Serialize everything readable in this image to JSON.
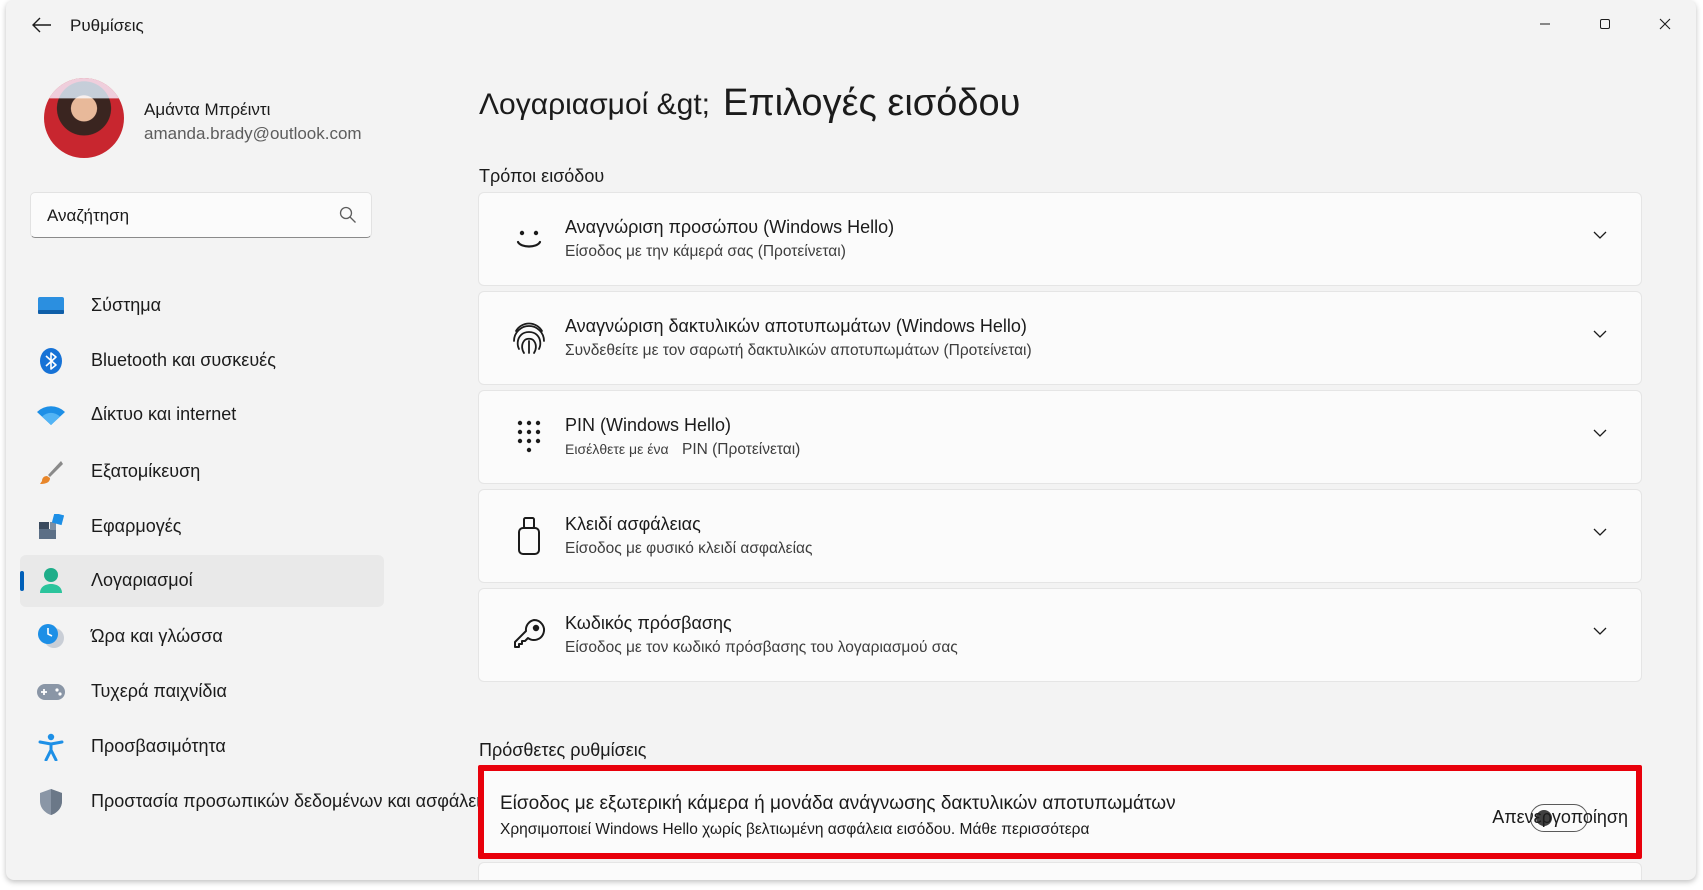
{
  "window": {
    "title": "Ρυθμίσεις"
  },
  "profile": {
    "name": "Αμάντα Μπρέιντι",
    "email": "amanda.brady@outlook.com"
  },
  "search": {
    "placeholder": "Αναζήτηση"
  },
  "nav": {
    "items": [
      {
        "label": "Σύστημα",
        "icon": "monitor-icon"
      },
      {
        "label": "Bluetooth και συσκευές",
        "icon": "bluetooth-icon"
      },
      {
        "label": "Δίκτυο και internet",
        "icon": "wifi-icon"
      },
      {
        "label": "Εξατομίκευση",
        "icon": "paintbrush-icon"
      },
      {
        "label": "Εφαρμογές",
        "icon": "apps-icon"
      },
      {
        "label": "Λογαριασμοί",
        "icon": "account-icon",
        "selected": true
      },
      {
        "label": "Ώρα και γλώσσα",
        "icon": "clock-globe-icon"
      },
      {
        "label": "Τυχερά παιχνίδια",
        "icon": "gamepad-icon"
      },
      {
        "label": "Προσβασιμότητα",
        "icon": "accessibility-icon"
      },
      {
        "label": "Προστασία προσωπικών δεδομένων και ασφάλεια",
        "icon": "shield-icon"
      }
    ]
  },
  "breadcrumb": {
    "parent": "Λογαριασμοί &gt;",
    "current": "Επιλογές εισόδου"
  },
  "sections": {
    "ways_title": "Τρόποι εισόδου",
    "additional_title": "Πρόσθετες ρυθμίσεις"
  },
  "signin_options": [
    {
      "title": "Αναγνώριση προσώπου (Windows Hello)",
      "subtitle": "Είσοδος με την κάμερά σας (Προτείνεται)",
      "icon": "face-icon"
    },
    {
      "title": "Αναγνώριση δακτυλικών αποτυπωμάτων (Windows Hello)",
      "subtitle": "Συνδεθείτε με τον σαρωτή δακτυλικών αποτυπωμάτων (Προτείνεται)",
      "icon": "fingerprint-icon"
    },
    {
      "title": "PIN (Windows Hello)",
      "subtitle_a": "Εισέλθετε με ένα",
      "subtitle_b": "PIN (Προτείνεται)",
      "icon": "keypad-icon"
    },
    {
      "title": "Κλειδί ασφάλειας",
      "subtitle": "Είσοδος με φυσικό κλειδί ασφαλείας",
      "icon": "usb-key-icon"
    },
    {
      "title": "Κωδικός πρόσβασης",
      "subtitle": "Είσοδος με τον κωδικό πρόσβασης του λογαριασμού σας",
      "icon": "key-icon"
    }
  ],
  "additional": {
    "title": "Είσοδος με εξωτερική κάμερα ή μονάδα ανάγνωσης δακτυλικών αποτυπωμάτων",
    "subtitle": "Χρησιμοποιεί Windows Hello χωρίς βελτιωμένη ασφάλεια εισόδου. Μάθε περισσότερα",
    "toggle_label": "Απενεργοποίηση",
    "toggle_on": false,
    "highlight_color": "#e8000b"
  },
  "colors": {
    "accent": "#005fb8",
    "window_bg": "#f3f3f3",
    "card_bg": "#fbfbfb"
  }
}
